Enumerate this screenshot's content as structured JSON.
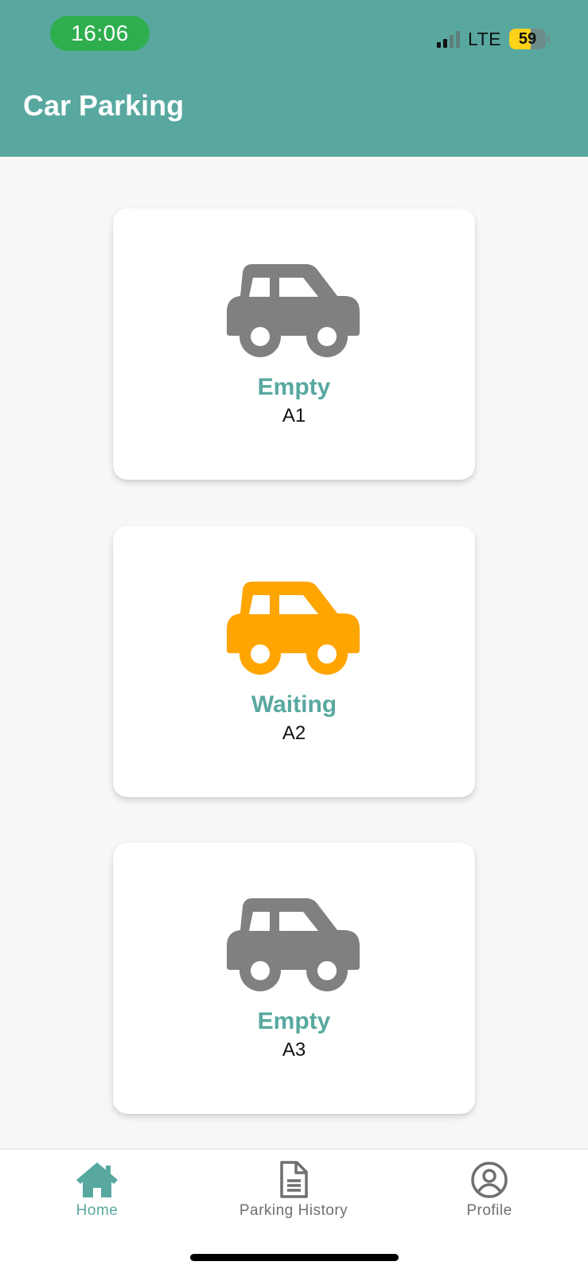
{
  "status_bar": {
    "time": "16:06",
    "network": "LTE",
    "battery_percent": "59",
    "battery_level": 0.59,
    "signal_bars_active": 2,
    "signal_bars_total": 4
  },
  "header": {
    "title": "Car Parking"
  },
  "colors": {
    "primary": "#58a8a0",
    "empty": "#808080",
    "waiting": "#ffa500",
    "inactive_nav": "#6f6f6f"
  },
  "slots": [
    {
      "status": "Empty",
      "id": "A1",
      "icon": "car-icon",
      "icon_color": "#808080"
    },
    {
      "status": "Waiting",
      "id": "A2",
      "icon": "car-icon",
      "icon_color": "#ffa500"
    },
    {
      "status": "Empty",
      "id": "A3",
      "icon": "car-icon",
      "icon_color": "#808080"
    }
  ],
  "bottom_nav": {
    "items": [
      {
        "label": "Home",
        "icon": "home-icon",
        "active": true
      },
      {
        "label": "Parking History",
        "icon": "document-icon",
        "active": false
      },
      {
        "label": "Profile",
        "icon": "profile-icon",
        "active": false
      }
    ]
  }
}
